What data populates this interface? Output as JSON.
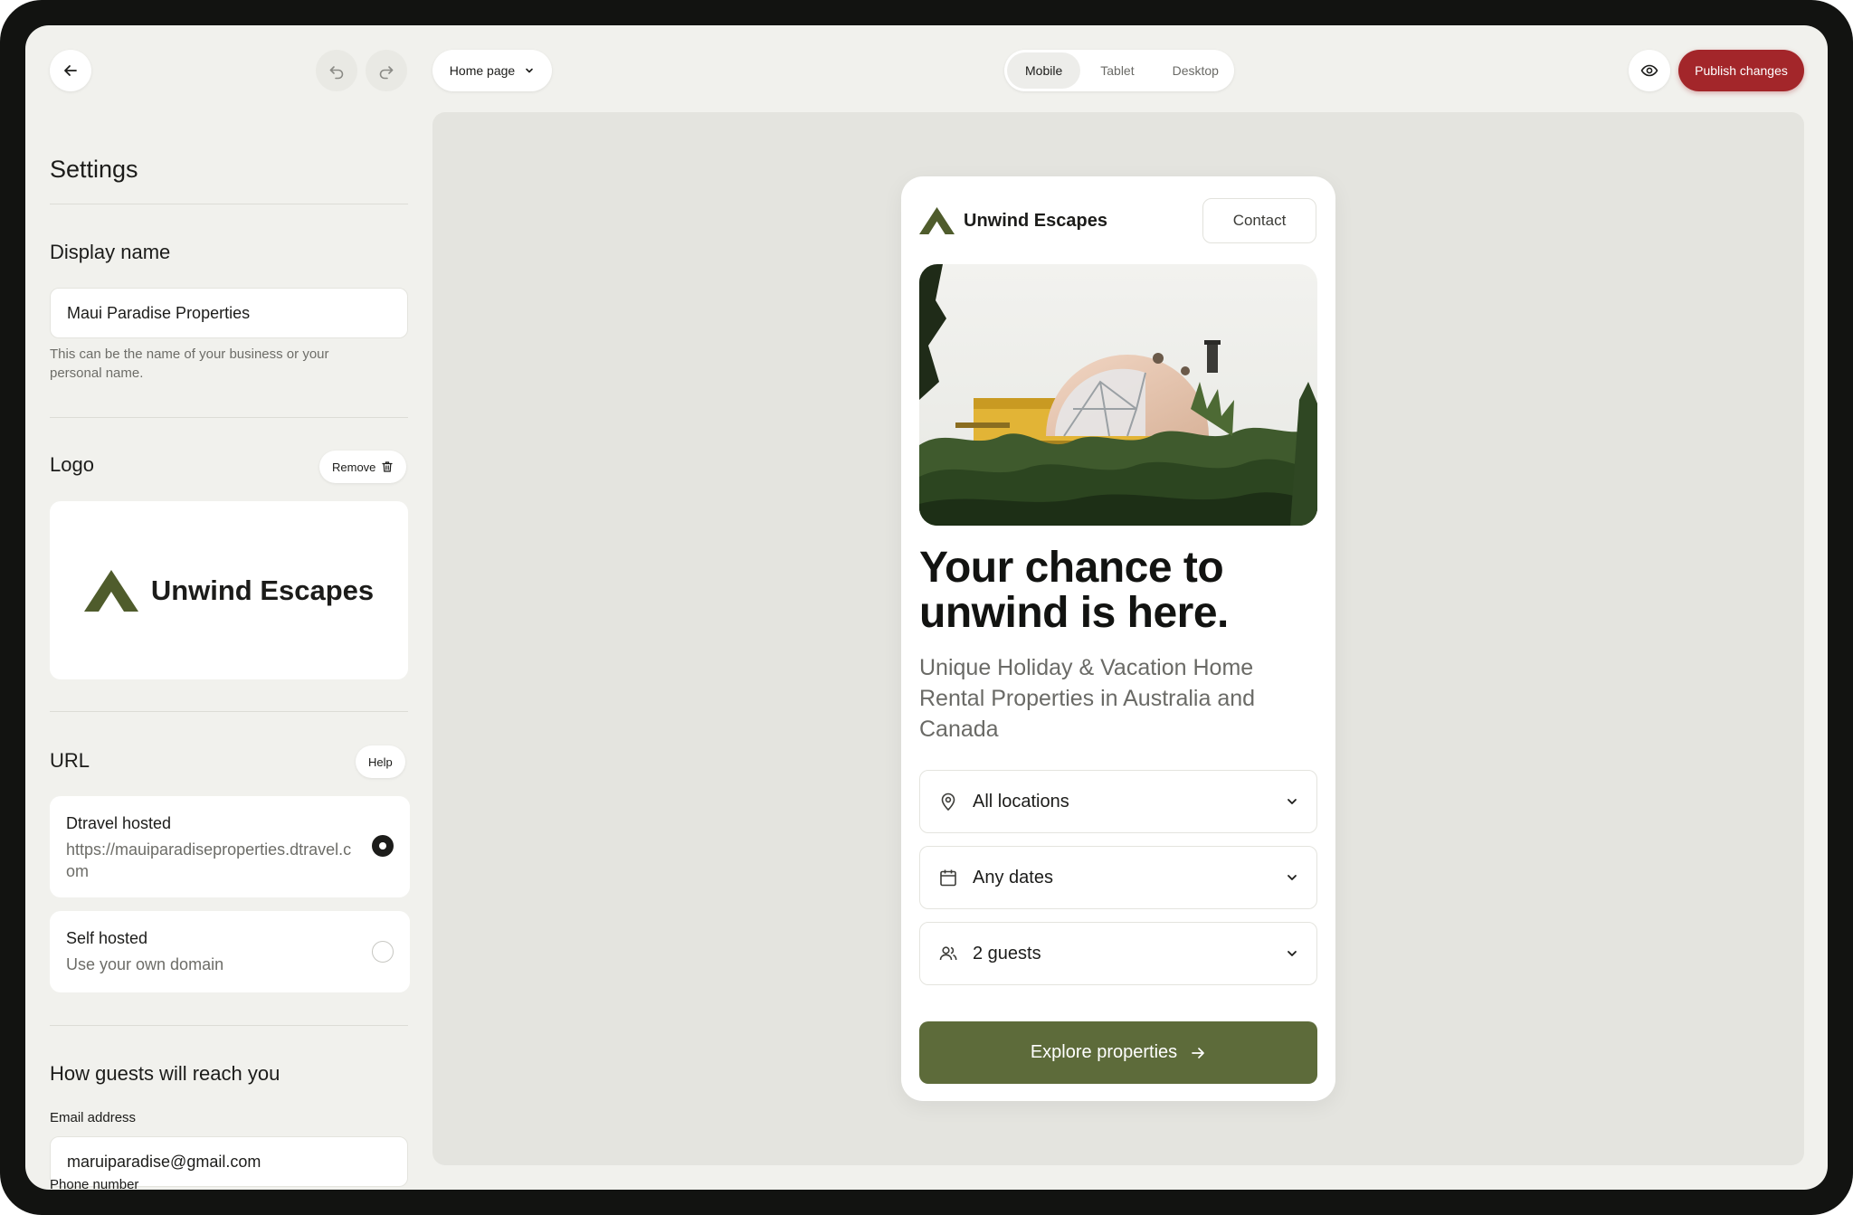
{
  "topbar": {
    "page_select": "Home page",
    "device_tabs": [
      "Mobile",
      "Tablet",
      "Desktop"
    ],
    "active_device": "Mobile",
    "publish_label": "Publish changes",
    "publish_color": "#a3262a"
  },
  "settings": {
    "title": "Settings",
    "display_name": {
      "label": "Display name",
      "value": "Maui Paradise Properties",
      "hint": "This can be the name of your business or your personal name."
    },
    "logo": {
      "label": "Logo",
      "remove_label": "Remove",
      "brand_name": "Unwind Escapes"
    },
    "url": {
      "label": "URL",
      "help_label": "Help",
      "options": [
        {
          "title": "Dtravel hosted",
          "subtitle": "https://mauiparadiseproperties.dtravel.com",
          "selected": true
        },
        {
          "title": "Self hosted",
          "subtitle": "Use your own domain",
          "selected": false
        }
      ]
    },
    "reach": {
      "label": "How guests will reach you",
      "email_label": "Email address",
      "email_value": "maruiparadise@gmail.com",
      "phone_label": "Phone number"
    }
  },
  "preview": {
    "brand_name": "Unwind Escapes",
    "brand_color": "#4f5c2c",
    "contact_label": "Contact",
    "headline": "Your chance to unwind is here.",
    "subheadline": "Unique Holiday & Vacation Home Rental Properties in Australia and Canada",
    "filters": [
      {
        "icon": "location-pin-icon",
        "label": "All locations"
      },
      {
        "icon": "calendar-icon",
        "label": "Any dates"
      },
      {
        "icon": "guests-icon",
        "label": "2 guests"
      }
    ],
    "cta_label": "Explore properties",
    "cta_color": "#5d6b3a"
  }
}
